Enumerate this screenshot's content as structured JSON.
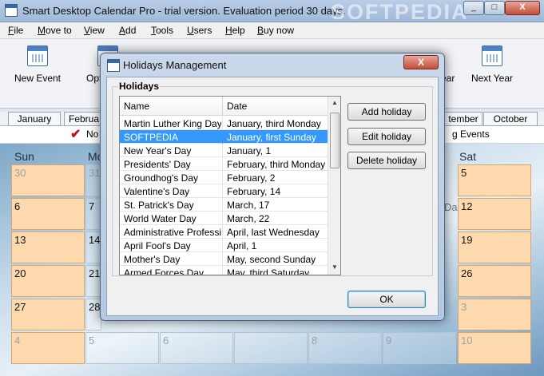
{
  "window": {
    "title": "Smart Desktop Calendar Pro - trial version. Evaluation period 30 days.",
    "watermark": "SOFTPEDIA",
    "min_glyph": "_",
    "max_glyph": "□",
    "close_glyph": "X"
  },
  "menu": [
    "File",
    "Move to",
    "View",
    "Add",
    "Tools",
    "Users",
    "Help",
    "Buy now"
  ],
  "toolbar": {
    "new_event": "New Event",
    "options": "Opt",
    "year": "ear",
    "next_year": "Next Year"
  },
  "months": {
    "january": "January",
    "february": "Februa",
    "september": "tember",
    "october": "October"
  },
  "infobar": {
    "check": "✔",
    "now": "No",
    "events": "g Events"
  },
  "calendar": {
    "day_headers": {
      "sun": "Sun",
      "mon": "Mo",
      "sat": "Sat"
    },
    "sun_col": [
      "30",
      "6",
      "13",
      "20",
      "27",
      "4"
    ],
    "mon_col": [
      "31",
      "7",
      "14",
      "21",
      "28",
      "5"
    ],
    "sat_col": [
      "5",
      "12",
      "19",
      "26",
      "3",
      "10"
    ],
    "bottom_row_extra": [
      "6",
      "8",
      "9"
    ],
    "partial_fri_label": "Da"
  },
  "dialog": {
    "title": "Holidays Management",
    "close_glyph": "X",
    "group_label": "Holidays",
    "columns": {
      "name": "Name",
      "date": "Date"
    },
    "rows": [
      {
        "name": "Martin Luther King Day",
        "date": "January, third Monday"
      },
      {
        "name": "SOFTPEDIA",
        "date": "January, first Sunday"
      },
      {
        "name": "New Year's Day",
        "date": "January, 1"
      },
      {
        "name": "Presidents' Day",
        "date": "February, third Monday"
      },
      {
        "name": "Groundhog's Day",
        "date": "February, 2"
      },
      {
        "name": "Valentine's Day",
        "date": "February, 14"
      },
      {
        "name": "St. Patrick's Day",
        "date": "March, 17"
      },
      {
        "name": "World Water Day",
        "date": "March, 22"
      },
      {
        "name": "Administrative Professio...",
        "date": "April, last Wednesday"
      },
      {
        "name": "April Fool's Day",
        "date": "April, 1"
      },
      {
        "name": "Mother's Day",
        "date": "May, second Sunday"
      },
      {
        "name": "Armed Forces Day",
        "date": "May, third Saturday"
      }
    ],
    "selected_index": 1,
    "add_label": "Add holiday",
    "edit_label": "Edit holiday",
    "delete_label": "Delete holiday",
    "ok_label": "OK",
    "scroll_up": "▲",
    "scroll_down": "▼"
  },
  "colors": {
    "selection": "#3399ff",
    "weekend_cell": "#fdd9ad",
    "close_button": "#c44d3a"
  }
}
